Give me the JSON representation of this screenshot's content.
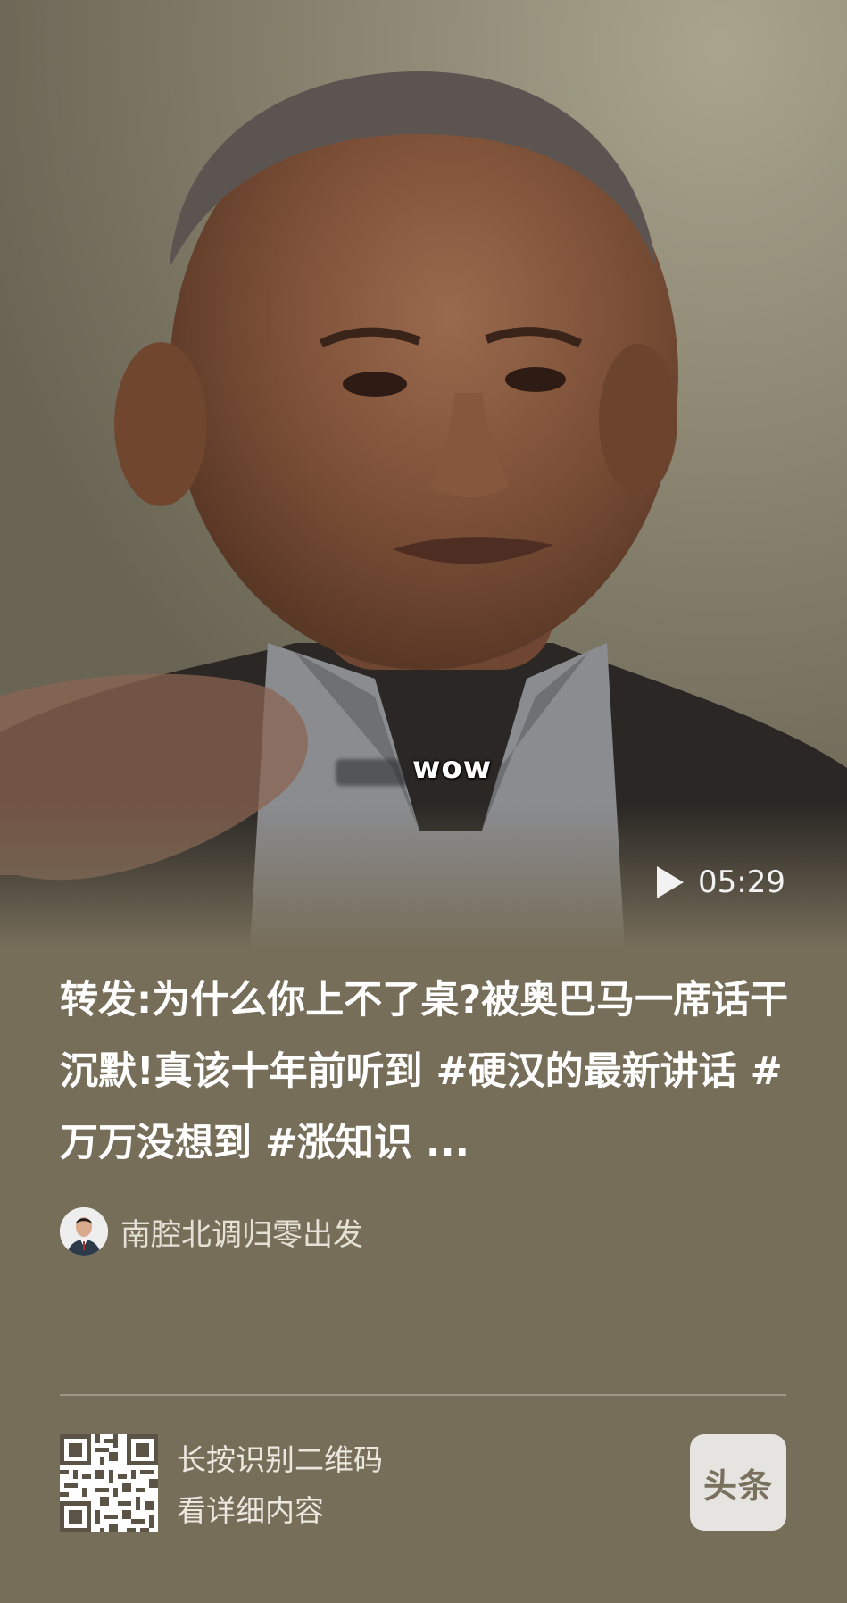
{
  "video": {
    "caption": "wow",
    "duration": "05:29",
    "play_icon": "play-icon"
  },
  "post": {
    "title": "转发:为什么你上不了桌?被奥巴马一席话干沉默!真该十年前听到 #硬汉的最新讲话 #万万没想到 #涨知识 ..."
  },
  "author": {
    "name": "南腔北调归零出发",
    "avatar_icon": "avatar"
  },
  "footer": {
    "qr_line1": "长按识别二维码",
    "qr_line2": "看详细内容",
    "brand_label": "头条"
  },
  "colors": {
    "background": "#776e5a",
    "title_text": "#ffffff",
    "secondary_text": "#e6e1d6"
  }
}
